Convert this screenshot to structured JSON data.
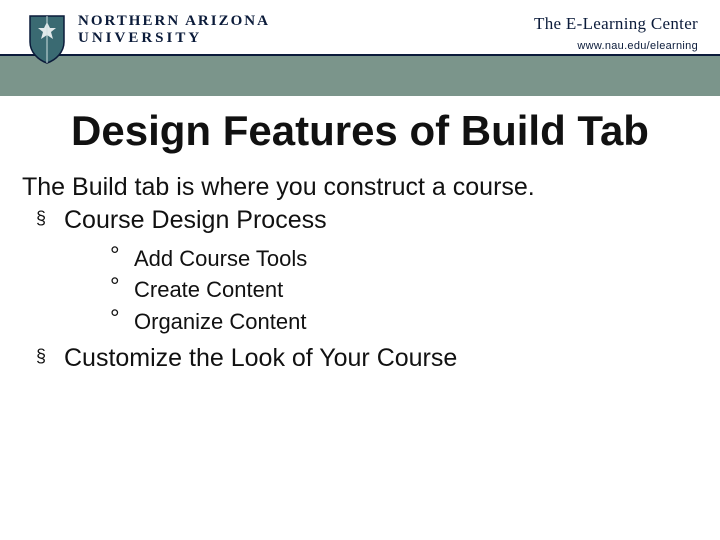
{
  "header": {
    "org_line1": "NORTHERN ARIZONA",
    "org_line2": "UNIVERSITY",
    "center_name": "The E-Learning Center",
    "url": "www.nau.edu/elearning"
  },
  "title": "Design Features of Build Tab",
  "intro": "The Build tab is where you construct a course.",
  "bullets": [
    {
      "label": "Course Design Process",
      "sub": [
        "Add Course Tools",
        "Create Content",
        "Organize Content"
      ]
    },
    {
      "label": "Customize the Look of Your Course",
      "sub": []
    }
  ]
}
